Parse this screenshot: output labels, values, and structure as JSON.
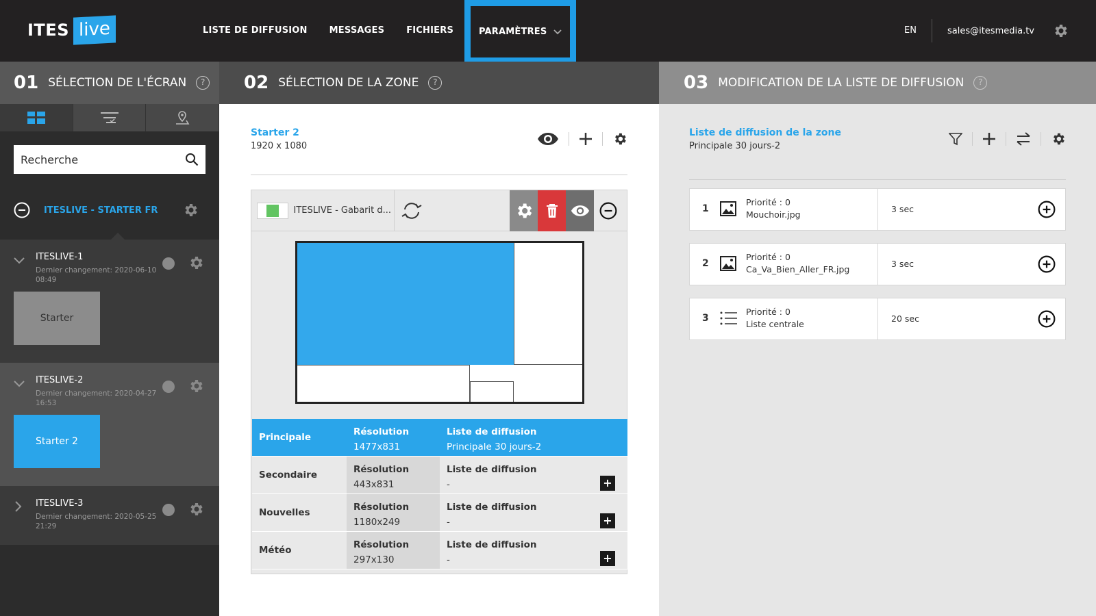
{
  "logo": {
    "text1": "ITES",
    "text2": "live"
  },
  "nav": {
    "items": [
      "LISTE DE DIFFUSION",
      "MESSAGES",
      "FICHIERS"
    ],
    "active": "PARAMÈTRES"
  },
  "top_right": {
    "lang": "EN",
    "email": "sales@itesmedia.tv"
  },
  "headers": {
    "h1": {
      "num": "01",
      "title": "SÉLECTION DE L'ÉCRAN"
    },
    "h2": {
      "num": "02",
      "title": "SÉLECTION DE LA ZONE"
    },
    "h3": {
      "num": "03",
      "title": "MODIFICATION DE LA LISTE DE DIFFUSION"
    },
    "help": "?"
  },
  "sidebar": {
    "search_placeholder": "Recherche",
    "group_label": "ITESLIVE - STARTER FR",
    "screens": [
      {
        "name": "ITESLIVE-1",
        "date": "Dernier changement: 2020-06-10 08:49",
        "tile": "Starter"
      },
      {
        "name": "ITESLIVE-2",
        "date": "Dernier changement: 2020-04-27 16:53",
        "tile": "Starter 2"
      },
      {
        "name": "ITESLIVE-3",
        "date": "Dernier changement: 2020-05-25 21:29"
      }
    ]
  },
  "zone": {
    "title": "Starter 2",
    "resolution": "1920 x 1080",
    "template_name": "ITESLIVE - Gabarit d...",
    "rows": [
      {
        "name": "Principale",
        "res_label": "Résolution",
        "res": "1477x831",
        "list_label": "Liste de diffusion",
        "list": "Principale 30 jours-2"
      },
      {
        "name": "Secondaire",
        "res_label": "Résolution",
        "res": "443x831",
        "list_label": "Liste de diffusion",
        "list": "-"
      },
      {
        "name": "Nouvelles",
        "res_label": "Résolution",
        "res": "1180x249",
        "list_label": "Liste de diffusion",
        "list": "-"
      },
      {
        "name": "Météo",
        "res_label": "Résolution",
        "res": "297x130",
        "list_label": "Liste de diffusion",
        "list": "-"
      }
    ],
    "add_symbol": "+"
  },
  "playlist": {
    "title": "Liste de diffusion de la zone",
    "subtitle": "Principale 30 jours-2",
    "items": [
      {
        "idx": "1",
        "priority": "Priorité : 0",
        "name": "Mouchoir.jpg",
        "duration": "3 sec",
        "icon": "image-icon"
      },
      {
        "idx": "2",
        "priority": "Priorité : 0",
        "name": "Ca_Va_Bien_Aller_FR.jpg",
        "duration": "3 sec",
        "icon": "image-icon"
      },
      {
        "idx": "3",
        "priority": "Priorité : 0",
        "name": "Liste centrale",
        "duration": "20 sec",
        "icon": "list-icon"
      }
    ]
  },
  "colors": {
    "accent": "#2aa5ea",
    "nav_bg": "#232122",
    "delete": "#d9383a",
    "swatch": "#62c462"
  }
}
